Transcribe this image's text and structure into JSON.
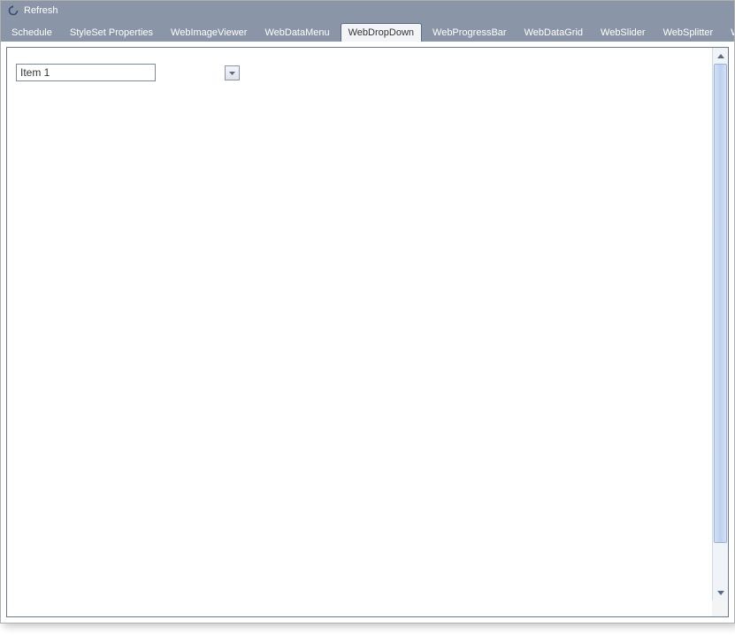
{
  "header": {
    "refresh_label": "Refresh"
  },
  "tabs": [
    {
      "label": "Schedule",
      "active": false
    },
    {
      "label": "StyleSet Properties",
      "active": false
    },
    {
      "label": "WebImageViewer",
      "active": false
    },
    {
      "label": "WebDataMenu",
      "active": false
    },
    {
      "label": "WebDropDown",
      "active": true
    },
    {
      "label": "WebProgressBar",
      "active": false
    },
    {
      "label": "WebDataGrid",
      "active": false
    },
    {
      "label": "WebSlider",
      "active": false
    },
    {
      "label": "WebSplitter",
      "active": false
    },
    {
      "label": "WebDialog",
      "active": false
    }
  ],
  "dropdown": {
    "value": "Item 1"
  }
}
